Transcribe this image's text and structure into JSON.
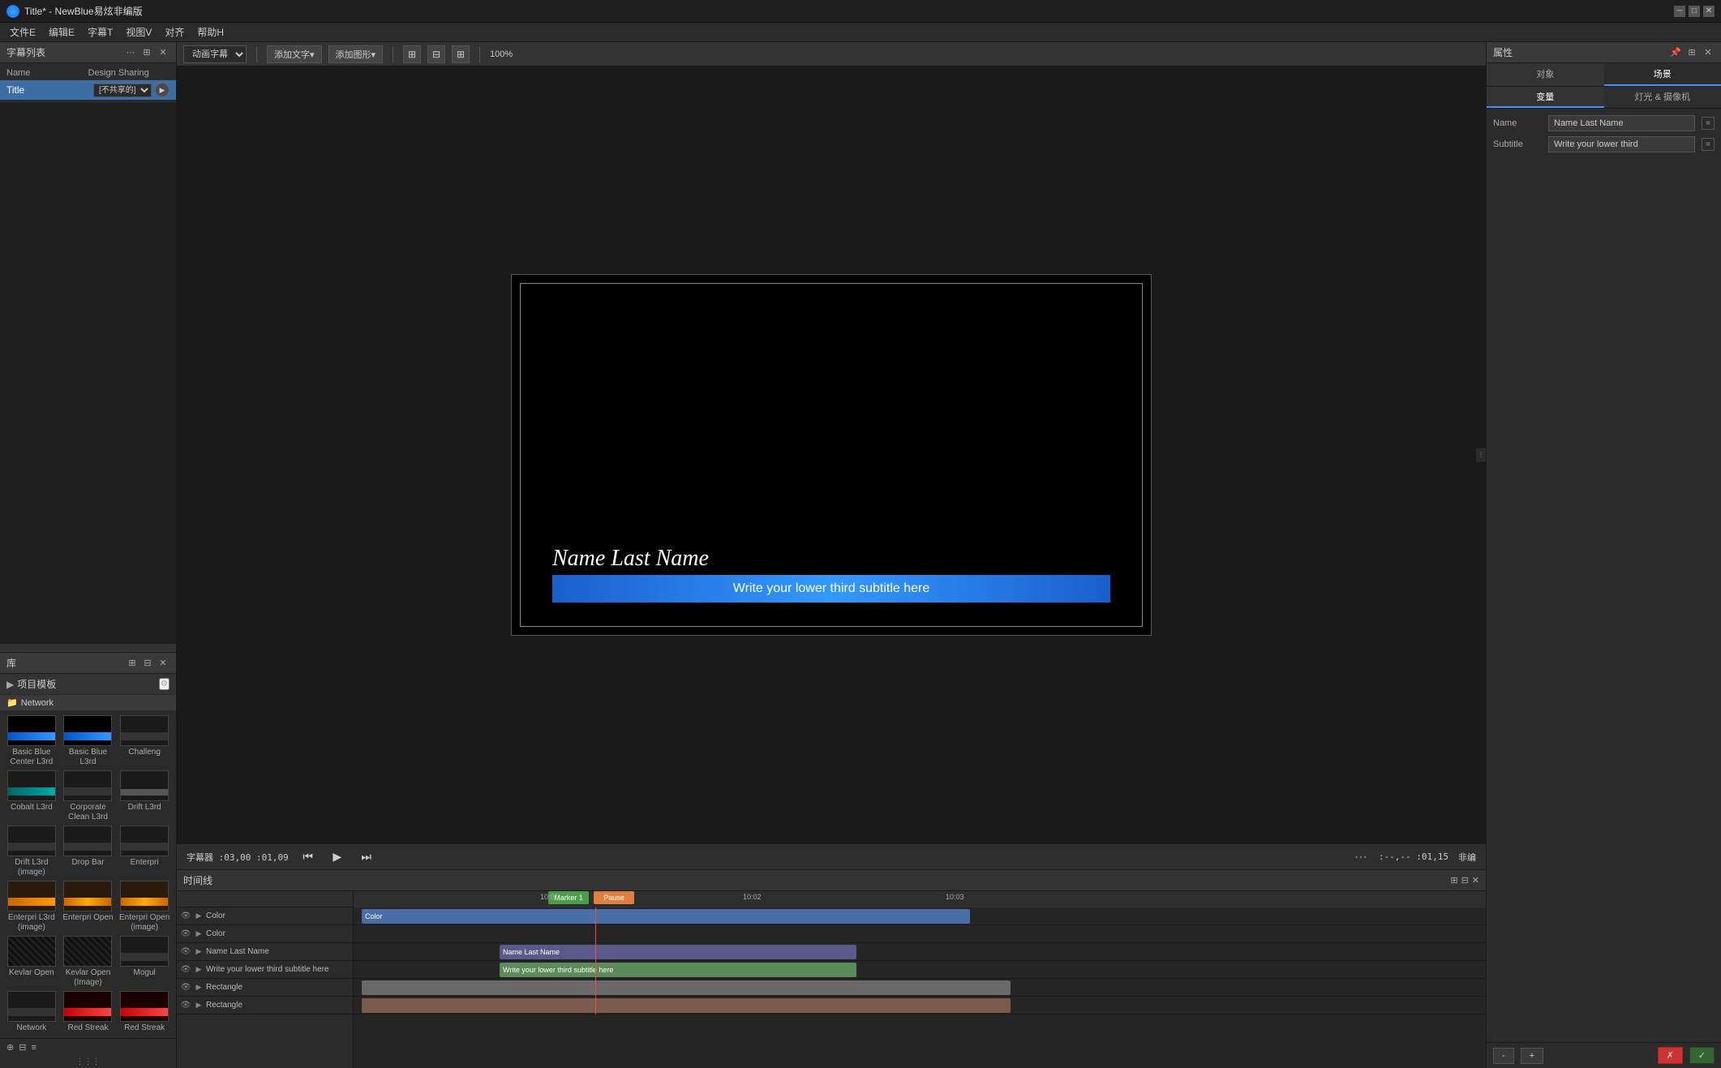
{
  "window": {
    "title": "Title* - NewBlue易炫非编版"
  },
  "menubar": {
    "items": [
      "文件E",
      "编辑E",
      "字幕T",
      "视图V",
      "对齐",
      "帮助H"
    ]
  },
  "left_panel": {
    "title": "字幕列表",
    "col_name": "Name",
    "col_sharing": "Design Sharing",
    "row_name": "Title",
    "row_sharing": "[不共享的]"
  },
  "library": {
    "title": "库",
    "section_title": "项目模板",
    "network_label": "Network",
    "templates": [
      {
        "label": "Basic Blue Center L3rd",
        "type": "blue"
      },
      {
        "label": "Basic Blue L3rd",
        "type": "blue"
      },
      {
        "label": "Challeng",
        "type": "dark"
      },
      {
        "label": "Cobalt L3rd",
        "type": "teal"
      },
      {
        "label": "Corporate Clean L3rd",
        "type": "dark"
      },
      {
        "label": "Drift L3rd",
        "type": "dark"
      },
      {
        "label": "Drift L3rd (image)",
        "type": "dark"
      },
      {
        "label": "Drop Bar",
        "type": "dark"
      },
      {
        "label": "Enterpri",
        "type": "dark"
      },
      {
        "label": "Enterpri L3rd (image)",
        "type": "orange"
      },
      {
        "label": "Enterpri Open",
        "type": "orange"
      },
      {
        "label": "Enterpri Open (image)",
        "type": "orange"
      },
      {
        "label": "Kevlar Open",
        "type": "dark_streak"
      },
      {
        "label": "Kevlar Open (Image)",
        "type": "dark_streak"
      },
      {
        "label": "Mogul",
        "type": "dark"
      },
      {
        "label": "Network",
        "type": "dark"
      },
      {
        "label": "Red Streak",
        "type": "red"
      },
      {
        "label": "Red Streak",
        "type": "red"
      }
    ]
  },
  "toolbar": {
    "dropdown_label": "动画字幕",
    "add_text_label": "添加文字▾",
    "add_shape_label": "添加图形▾",
    "zoom_label": "100%"
  },
  "preview": {
    "name_text": "Name Last Name",
    "subtitle_text": "Write your lower third subtitle here"
  },
  "player": {
    "timecode_left": "字幕器 :03,00 :01,09",
    "timecode_right": ":--,-- :01,15",
    "mode": "非编"
  },
  "timeline": {
    "title": "时间线",
    "tracks": [
      {
        "name": "Color",
        "block_text": "Color",
        "type": "color"
      },
      {
        "name": "Color",
        "block_text": "",
        "type": "color_small"
      },
      {
        "name": "Name Last Name",
        "block_text": "Name Last Name",
        "type": "name"
      },
      {
        "name": "Write your lower third subtitle here",
        "block_text": "Write your lower third subtitle here",
        "type": "subtitle"
      },
      {
        "name": "Rectangle",
        "block_text": "",
        "type": "rect1"
      },
      {
        "name": "Rectangle",
        "block_text": "",
        "type": "rect2"
      }
    ],
    "markers": [
      {
        "label": "Marker 1",
        "color": "green"
      },
      {
        "label": "Pause",
        "color": "orange"
      }
    ],
    "time_labels": [
      "10:01",
      "10:02",
      "10:03"
    ]
  },
  "right_panel": {
    "title": "属性",
    "tabs": [
      "对象",
      "场景"
    ],
    "sub_tabs": [
      "变量",
      "灯光 & 摄像机"
    ],
    "active_tab": "场景",
    "active_sub_tab": "变量",
    "properties": [
      {
        "label": "Name",
        "value": "Name Last Name"
      },
      {
        "label": "Subtitle",
        "value": "Write your lower third"
      }
    ]
  },
  "bottom_bar": {
    "minus_label": "-",
    "plus_label": "+",
    "cancel_label": "✗",
    "ok_label": "✓"
  },
  "write_lower_third": "Write your lower third"
}
